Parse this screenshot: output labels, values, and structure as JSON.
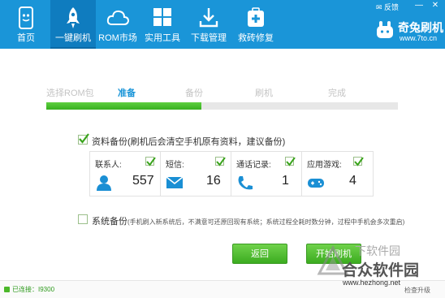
{
  "nav": {
    "items": [
      {
        "label": "首页",
        "icon": "phone-icon"
      },
      {
        "label": "一键刷机",
        "icon": "rocket-icon",
        "active": true
      },
      {
        "label": "ROM市场",
        "icon": "cloud-icon"
      },
      {
        "label": "实用工具",
        "icon": "grid-icon"
      },
      {
        "label": "下载管理",
        "icon": "download-icon"
      },
      {
        "label": "救砖修复",
        "icon": "medkit-icon"
      }
    ]
  },
  "titlebar": {
    "feedback": "反馈",
    "minimize": "—",
    "close": "✕"
  },
  "brand": {
    "name": "奇兔刷机",
    "url": "www.7to.cn"
  },
  "steps": [
    {
      "label": "选择ROM包"
    },
    {
      "label": "准备",
      "active": true
    },
    {
      "label": "备份"
    },
    {
      "label": "刷机"
    },
    {
      "label": "完成"
    }
  ],
  "progress": {
    "fraction": 0.44
  },
  "backup": {
    "label": "资料备份",
    "hint": "(刷机后会清空手机原有资料，建议备份)",
    "checked": true,
    "items": [
      {
        "label": "联系人:",
        "count": "557",
        "icon": "contact-icon"
      },
      {
        "label": "短信:",
        "count": "16",
        "icon": "sms-icon"
      },
      {
        "label": "通话记录:",
        "count": "1",
        "icon": "call-log-icon"
      },
      {
        "label": "应用游戏:",
        "count": "4",
        "icon": "gamepad-icon"
      }
    ]
  },
  "system_backup": {
    "label": "系统备份",
    "hint": "(手机刷入新系统后，不满意可还原回现有系统；系统过程全耗时数分钟，过程中手机会多次重启)",
    "checked": false
  },
  "buttons": {
    "back": "返回",
    "start": "开始刷机"
  },
  "status": {
    "connected": "已连接：I9300",
    "right": "检查升级"
  },
  "watermark": {
    "top": "下软件园",
    "big": "合众软件园",
    "url": "www.hezhong.net"
  },
  "colors": {
    "accent": "#1a95d8",
    "green": "#3cac20"
  }
}
